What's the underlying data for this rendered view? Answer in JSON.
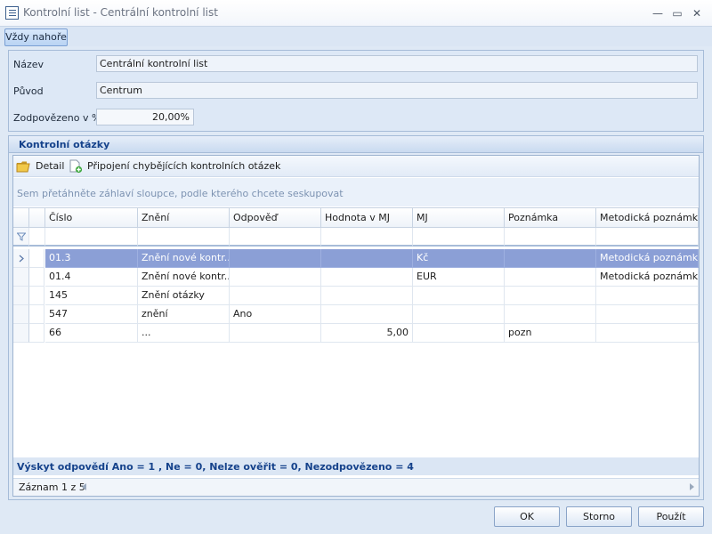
{
  "window": {
    "title": "Kontrolní list - Centrální kontrolní list",
    "icon": "checklist-icon",
    "controls": {
      "minimize": "—",
      "maximize": "▭",
      "close": "✕"
    }
  },
  "toolbar": {
    "always_on_top": "Vždy nahoře"
  },
  "header": {
    "name_label": "Název",
    "name_value": "Centrální kontrolní list",
    "origin_label": "Původ",
    "origin_value": "Centrum",
    "answered_label": "Zodpovězeno v %",
    "answered_value": "20,00%"
  },
  "questions": {
    "title": "Kontrolní otázky",
    "toolbar": {
      "detail": "Detail",
      "attach": "Připojení chybějících kontrolních otázek"
    },
    "groupby_hint": "Sem přetáhněte záhlaví sloupce, podle kterého chcete seskupovat",
    "columns": [
      "Číslo",
      "Znění",
      "Odpověď",
      "Hodnota v MJ",
      "MJ",
      "Poznámka",
      "Metodická poznámka"
    ],
    "rows": [
      {
        "cislo": "01.3",
        "zneni": "Znění nové kontr...",
        "odpoved": "",
        "hodnota": "",
        "mj": "Kč",
        "poznamka": "",
        "metodicka": "Metodická poznámk...",
        "selected": true
      },
      {
        "cislo": "01.4",
        "zneni": "Znění nové kontr...",
        "odpoved": "",
        "hodnota": "",
        "mj": "EUR",
        "poznamka": "",
        "metodicka": "Metodická poznámk..."
      },
      {
        "cislo": "145",
        "zneni": "Znění otázky",
        "odpoved": "",
        "hodnota": "",
        "mj": "",
        "poznamka": "",
        "metodicka": ""
      },
      {
        "cislo": "547",
        "zneni": "znění",
        "odpoved": "Ano",
        "hodnota": "",
        "mj": "",
        "poznamka": "",
        "metodicka": ""
      },
      {
        "cislo": "66",
        "zneni": "...",
        "odpoved": "",
        "hodnota": "5,00",
        "mj": "",
        "poznamka": "pozn",
        "metodicka": ""
      }
    ],
    "summary": "Výskyt odpovědí Ano = 1 , Ne = 0, Nelze ověřit = 0, Nezodpovězeno = 4",
    "pager": "Záznam 1 z 5"
  },
  "buttons": {
    "ok": "OK",
    "cancel": "Storno",
    "apply": "Použít"
  },
  "colors": {
    "selection": "#8b9fd6",
    "accent": "#15428b"
  }
}
